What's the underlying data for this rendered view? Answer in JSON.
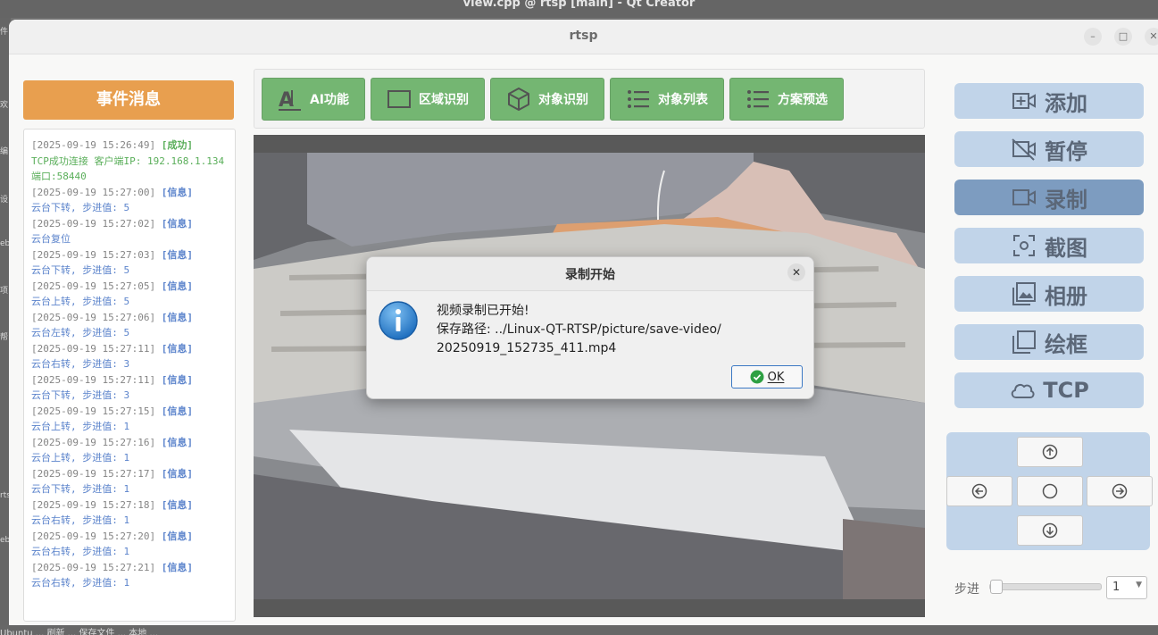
{
  "background": {
    "window_title": "view.cpp @ rtsp [main] - Qt Creator",
    "left_fragments": [
      "件",
      "欢",
      "编",
      "设",
      "eb",
      "项",
      "帮",
      "rts",
      "eb"
    ],
    "bottom_text": "Ubuntu ... 刷新 ... 保存文件 ... 本地 ..."
  },
  "app": {
    "title": "rtsp",
    "window_buttons": {
      "minimize": "–",
      "maximize": "□",
      "close": "✕"
    }
  },
  "events": {
    "header": "事件消息",
    "entries": [
      {
        "time": "[2025-09-19 15:26:49]",
        "tag": "[成功]",
        "kind": "ok",
        "msg": "TCP成功连接 客户端IP: 192.168.1.134 端口:58440"
      },
      {
        "time": "[2025-09-19 15:27:00]",
        "tag": "[信息]",
        "kind": "info",
        "msg": "云台下转, 步进值: 5"
      },
      {
        "time": "[2025-09-19 15:27:02]",
        "tag": "[信息]",
        "kind": "info",
        "msg": "云台复位"
      },
      {
        "time": "[2025-09-19 15:27:03]",
        "tag": "[信息]",
        "kind": "info",
        "msg": "云台下转, 步进值: 5"
      },
      {
        "time": "[2025-09-19 15:27:05]",
        "tag": "[信息]",
        "kind": "info",
        "msg": "云台上转, 步进值: 5"
      },
      {
        "time": "[2025-09-19 15:27:06]",
        "tag": "[信息]",
        "kind": "info",
        "msg": "云台左转, 步进值: 5"
      },
      {
        "time": "[2025-09-19 15:27:11]",
        "tag": "[信息]",
        "kind": "info",
        "msg": "云台右转, 步进值: 3"
      },
      {
        "time": "[2025-09-19 15:27:11]",
        "tag": "[信息]",
        "kind": "info",
        "msg": "云台下转, 步进值: 3"
      },
      {
        "time": "[2025-09-19 15:27:15]",
        "tag": "[信息]",
        "kind": "info",
        "msg": "云台上转, 步进值: 1"
      },
      {
        "time": "[2025-09-19 15:27:16]",
        "tag": "[信息]",
        "kind": "info",
        "msg": "云台上转, 步进值: 1"
      },
      {
        "time": "[2025-09-19 15:27:17]",
        "tag": "[信息]",
        "kind": "info",
        "msg": "云台下转, 步进值: 1"
      },
      {
        "time": "[2025-09-19 15:27:18]",
        "tag": "[信息]",
        "kind": "info",
        "msg": "云台右转, 步进值: 1"
      },
      {
        "time": "[2025-09-19 15:27:20]",
        "tag": "[信息]",
        "kind": "info",
        "msg": "云台右转, 步进值: 1"
      },
      {
        "time": "[2025-09-19 15:27:21]",
        "tag": "[信息]",
        "kind": "info",
        "msg": "云台右转, 步进值: 1"
      }
    ]
  },
  "toolbar": {
    "ai": "AI功能",
    "region": "区域识别",
    "object": "对象识别",
    "object_list": "对象列表",
    "plan": "方案预选"
  },
  "side": {
    "add": "添加",
    "pause": "暂停",
    "record": "录制",
    "screenshot": "截图",
    "album": "相册",
    "draw": "绘框",
    "tcp": "TCP"
  },
  "step": {
    "label": "步进",
    "value": "1",
    "slider_fraction": 0.0
  },
  "dialog": {
    "title": "录制开始",
    "close": "✕",
    "line1": "视频录制已开始!",
    "line2": "保存路径: ../Linux-QT-RTSP/picture/save-video/",
    "line3": "20250919_152735_411.mp4",
    "ok": "OK"
  },
  "colors": {
    "event_header": "#e07b0c",
    "toolbar_button": "#3f9a3c",
    "side_button": "#a9c4e1",
    "side_button_active": "#4b77a8",
    "log_ok": "#1a8f1a",
    "log_info": "#1c54b8"
  }
}
